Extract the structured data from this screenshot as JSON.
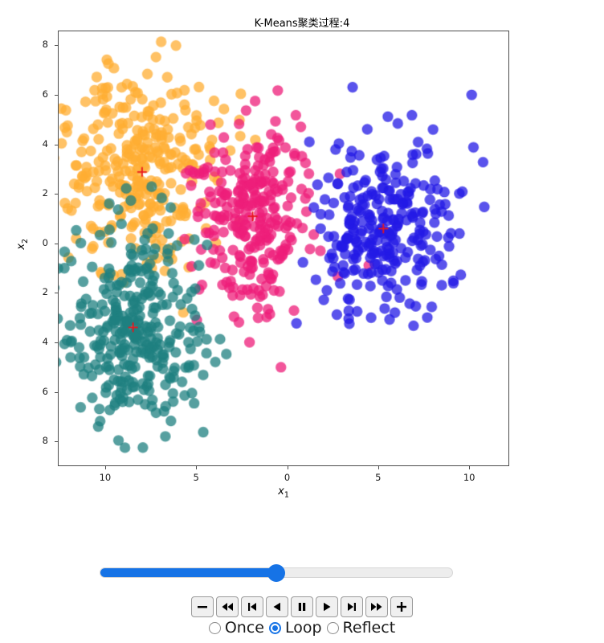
{
  "figure": {
    "title": "K-Means聚类过程:4",
    "iteration": 4
  },
  "axis": {
    "xlabel_base": "x",
    "xlabel_sub": "1",
    "ylabel_base": "x",
    "ylabel_sub": "2",
    "xticks": [
      "10",
      "5",
      "0",
      "5",
      "10"
    ],
    "yticks": [
      "8",
      "6",
      "4",
      "2",
      "0",
      "2",
      "4",
      "6",
      "8"
    ]
  },
  "slider": {
    "name": "frame-slider",
    "value_fraction": 0.5,
    "fill_color": "#1673e6",
    "track_color": "#ededed"
  },
  "buttons": [
    {
      "name": "decrease-speed-button",
      "icon": "minus-icon",
      "label": "-"
    },
    {
      "name": "jump-to-start-button",
      "icon": "skip-backward-icon",
      "label": "|<<"
    },
    {
      "name": "step-backward-button",
      "icon": "step-backward-icon",
      "label": "|<"
    },
    {
      "name": "play-backward-button",
      "icon": "play-backward-icon",
      "label": "<"
    },
    {
      "name": "pause-button",
      "icon": "pause-icon",
      "label": "||"
    },
    {
      "name": "play-forward-button",
      "icon": "play-forward-icon",
      "label": ">"
    },
    {
      "name": "step-forward-button",
      "icon": "step-forward-icon",
      "label": ">|"
    },
    {
      "name": "jump-to-end-button",
      "icon": "skip-forward-icon",
      "label": ">>|"
    },
    {
      "name": "increase-speed-button",
      "icon": "plus-icon",
      "label": "+"
    }
  ],
  "radios": {
    "selected": "Loop",
    "options": [
      {
        "label": "Once",
        "selected": false
      },
      {
        "label": "Loop",
        "selected": true
      },
      {
        "label": "Reflect",
        "selected": false
      }
    ]
  },
  "chart_data": {
    "type": "scatter",
    "title": "K-Means聚类过程:4",
    "xlabel": "x1",
    "ylabel": "x2",
    "xlim": [
      -12.6,
      12.2
    ],
    "ylim": [
      -9.0,
      8.6
    ],
    "xticks": [
      -10,
      -5,
      0,
      5,
      10
    ],
    "yticks": [
      8,
      6,
      4,
      2,
      0,
      -2,
      -4,
      -6,
      -8
    ],
    "grid": false,
    "legend": null,
    "n_clusters": 4,
    "point_size": 9,
    "point_alpha": 0.75,
    "centroid_marker": "+",
    "centroid_color": "#e8161d",
    "series": [
      {
        "name": "cluster-orange",
        "color": "#ffae33",
        "n_points": 320,
        "center": [
          -8.0,
          2.9
        ],
        "spread": [
          2.1,
          2.0
        ],
        "centroid": [
          -8.0,
          2.9
        ]
      },
      {
        "name": "cluster-pink",
        "color": "#ed1e79",
        "n_points": 270,
        "center": [
          -1.9,
          1.1
        ],
        "spread": [
          1.7,
          1.9
        ],
        "centroid": [
          -1.9,
          1.1
        ]
      },
      {
        "name": "cluster-blue",
        "color": "#2319e6",
        "n_points": 280,
        "center": [
          5.3,
          0.6
        ],
        "spread": [
          2.0,
          1.9
        ],
        "centroid": [
          5.3,
          0.6
        ]
      },
      {
        "name": "cluster-teal",
        "color": "#1f8080",
        "n_points": 330,
        "center": [
          -8.5,
          -3.4
        ],
        "spread": [
          2.0,
          2.0
        ],
        "centroid": [
          -8.5,
          -3.4
        ]
      }
    ]
  }
}
